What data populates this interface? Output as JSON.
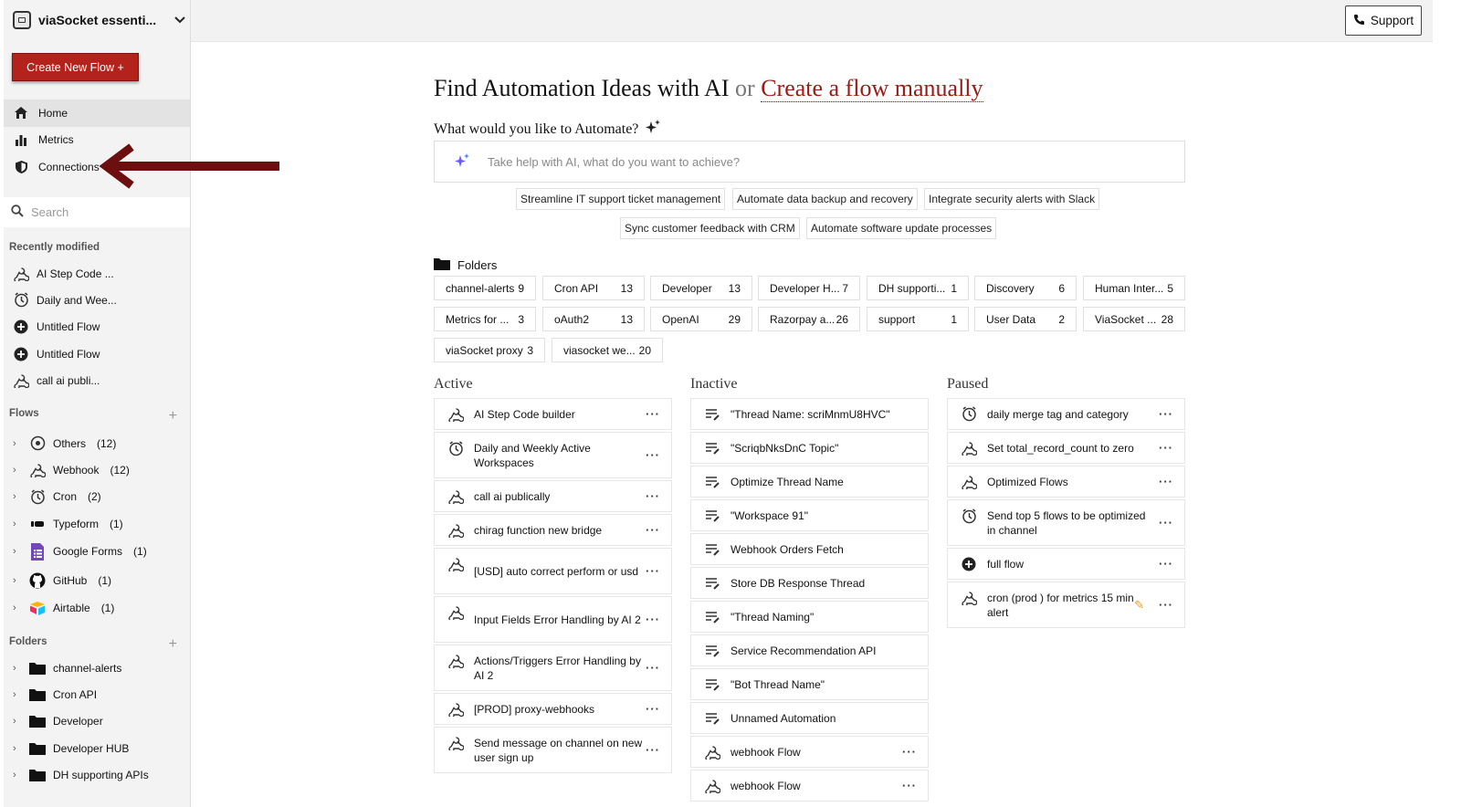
{
  "workspace": {
    "name": "viaSocket essenti..."
  },
  "sidebar": {
    "create_button": "Create New Flow +",
    "nav": [
      {
        "label": "Home",
        "icon": "home-icon"
      },
      {
        "label": "Metrics",
        "icon": "bar-chart-icon"
      },
      {
        "label": "Connections",
        "icon": "shield-icon"
      }
    ],
    "search_placeholder": "Search",
    "recent_title": "Recently modified",
    "recent": [
      {
        "label": "AI Step Code ...",
        "icon": "webhook-icon"
      },
      {
        "label": "Daily and Wee...",
        "icon": "clock-icon"
      },
      {
        "label": "Untitled Flow",
        "icon": "plus-circle-icon"
      },
      {
        "label": "Untitled Flow",
        "icon": "plus-circle-icon"
      },
      {
        "label": "call ai publi...",
        "icon": "webhook-icon"
      }
    ],
    "flows_title": "Flows",
    "flows": [
      {
        "label": "Others",
        "count": "(12)",
        "icon": "target-icon"
      },
      {
        "label": "Webhook",
        "count": "(12)",
        "icon": "webhook-icon"
      },
      {
        "label": "Cron",
        "count": "(2)",
        "icon": "clock-icon"
      },
      {
        "label": "Typeform",
        "count": "(1)",
        "icon": "typeform-icon"
      },
      {
        "label": "Google Forms",
        "count": "(1)",
        "icon": "google-forms-icon"
      },
      {
        "label": "GitHub",
        "count": "(1)",
        "icon": "github-icon"
      },
      {
        "label": "Airtable",
        "count": "(1)",
        "icon": "airtable-icon"
      }
    ],
    "folders_title": "Folders",
    "folders": [
      "channel-alerts",
      "Cron API",
      "Developer",
      "Developer HUB",
      "DH supporting APIs"
    ]
  },
  "topbar": {
    "support_label": "Support"
  },
  "main": {
    "headline_prefix": "Find Automation Ideas with AI",
    "headline_or": "or",
    "headline_link": "Create a flow manually",
    "subhead": "What would you like to Automate?",
    "ai_placeholder": "Take help with AI, what do you want to achieve?",
    "suggestions": [
      "Streamline IT support ticket management",
      "Automate data backup and recovery",
      "Integrate security alerts with Slack",
      "Sync customer feedback with CRM",
      "Automate software update processes"
    ],
    "folders_title": "Folders",
    "folders": [
      {
        "name": "channel-alerts",
        "count": "9"
      },
      {
        "name": "Cron API",
        "count": "13"
      },
      {
        "name": "Developer",
        "count": "13"
      },
      {
        "name": "Developer H...",
        "count": "7"
      },
      {
        "name": "DH supporti...",
        "count": "1"
      },
      {
        "name": "Discovery",
        "count": "6"
      },
      {
        "name": "Human Inter...",
        "count": "5"
      },
      {
        "name": "Metrics for ...",
        "count": "3"
      },
      {
        "name": "oAuth2",
        "count": "13"
      },
      {
        "name": "OpenAI",
        "count": "29"
      },
      {
        "name": "Razorpay a...",
        "count": "26"
      },
      {
        "name": "support",
        "count": "1"
      },
      {
        "name": "User Data",
        "count": "2"
      },
      {
        "name": "ViaSocket ...",
        "count": "28"
      },
      {
        "name": "viaSocket proxy",
        "count": "3"
      },
      {
        "name": "viasocket we...",
        "count": "20"
      }
    ],
    "active_title": "Active",
    "inactive_title": "Inactive",
    "paused_title": "Paused",
    "active": [
      {
        "label": "AI Step Code builder",
        "icon": "webhook-icon"
      },
      {
        "label": "Daily and Weekly Active Workspaces",
        "icon": "clock-icon"
      },
      {
        "label": "call ai publically",
        "icon": "webhook-icon"
      },
      {
        "label": "chirag function new bridge",
        "icon": "webhook-icon"
      },
      {
        "label": "[USD] auto correct perform or usd",
        "icon": "webhook-icon"
      },
      {
        "label": "Input Fields Error Handling by AI 2",
        "icon": "webhook-icon"
      },
      {
        "label": "Actions/Triggers Error Handling by AI 2",
        "icon": "webhook-icon"
      },
      {
        "label": "[PROD] proxy-webhooks",
        "icon": "webhook-icon"
      },
      {
        "label": "Send message on channel on new user sign up",
        "icon": "webhook-icon"
      }
    ],
    "inactive": [
      {
        "label": "\"Thread Name: scriMnmU8HVC\"",
        "icon": "edit-lines-icon"
      },
      {
        "label": "\"ScriqbNksDnC Topic\"",
        "icon": "edit-lines-icon"
      },
      {
        "label": "Optimize Thread Name",
        "icon": "edit-lines-icon"
      },
      {
        "label": "\"Workspace 91\"",
        "icon": "edit-lines-icon"
      },
      {
        "label": "Webhook Orders Fetch",
        "icon": "edit-lines-icon"
      },
      {
        "label": "Store DB Response Thread",
        "icon": "edit-lines-icon"
      },
      {
        "label": "\"Thread Naming\"",
        "icon": "edit-lines-icon"
      },
      {
        "label": "Service Recommendation API",
        "icon": "edit-lines-icon"
      },
      {
        "label": "\"Bot Thread Name\"",
        "icon": "edit-lines-icon"
      },
      {
        "label": "Unnamed Automation",
        "icon": "edit-lines-icon"
      },
      {
        "label": "webhook Flow",
        "icon": "webhook-icon"
      },
      {
        "label": "webhook Flow",
        "icon": "webhook-icon"
      }
    ],
    "paused": [
      {
        "label": "daily merge tag and category",
        "icon": "clock-icon"
      },
      {
        "label": "Set total_record_count to zero",
        "icon": "webhook-icon"
      },
      {
        "label": "Optimized Flows",
        "icon": "webhook-icon"
      },
      {
        "label": "Send top 5 flows to be optimized in channel",
        "icon": "clock-icon"
      },
      {
        "label": "full flow",
        "icon": "plus-circle-icon"
      },
      {
        "label": "cron (prod ) for metrics 15 min alert",
        "icon": "webhook-icon"
      }
    ],
    "more_label": "···"
  },
  "colors": {
    "brand": "#b3221b",
    "link": "#9b1a16",
    "arrow": "#6b0f0f"
  }
}
